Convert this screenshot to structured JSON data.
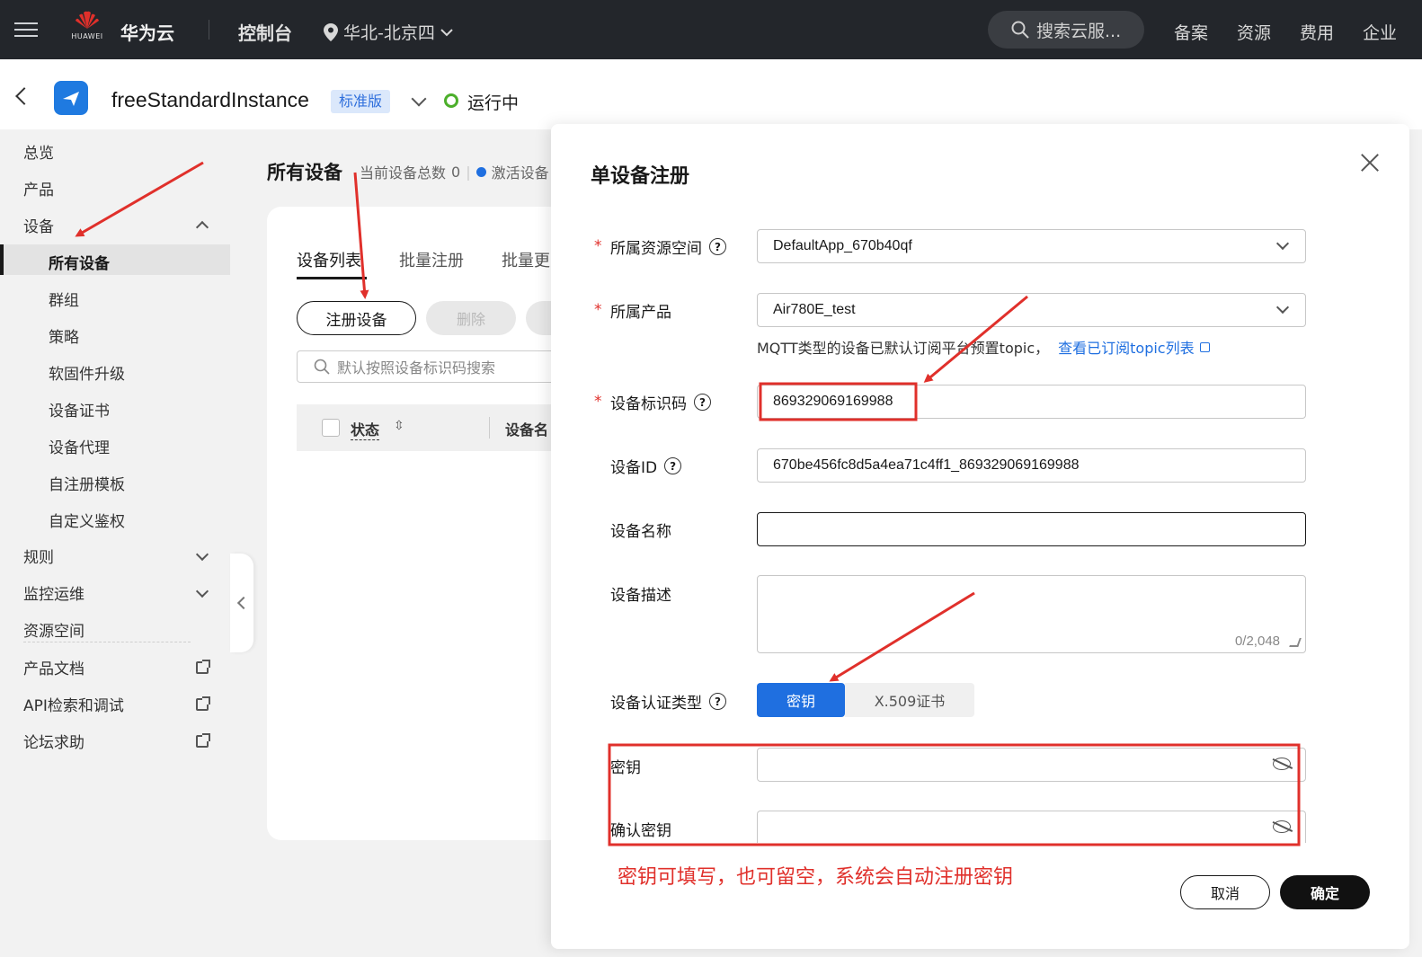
{
  "topbar": {
    "logo_text": "HUAWEI",
    "brand": "华为云",
    "console": "控制台",
    "region": "华北-北京四",
    "search_placeholder": "搜索云服...",
    "links": [
      "备案",
      "资源",
      "费用",
      "企业"
    ]
  },
  "instance": {
    "name": "freeStandardInstance",
    "edition": "标准版",
    "status": "运行中"
  },
  "sidebar": {
    "items": [
      {
        "label": "总览"
      },
      {
        "label": "产品"
      },
      {
        "label": "设备"
      }
    ],
    "device_sub": [
      "所有设备",
      "群组",
      "策略",
      "软固件升级",
      "设备证书",
      "设备代理",
      "自注册模板",
      "自定义鉴权"
    ],
    "more": [
      {
        "label": "规则"
      },
      {
        "label": "监控运维"
      },
      {
        "label": "资源空间"
      }
    ],
    "external": [
      {
        "label": "产品文档"
      },
      {
        "label": "API检索和调试"
      },
      {
        "label": "论坛求助"
      }
    ]
  },
  "main": {
    "title": "所有设备",
    "total_label": "当前设备总数",
    "total_value": "0",
    "active_label": "激活设备",
    "tabs": [
      "设备列表",
      "批量注册",
      "批量更"
    ],
    "register_button": "注册设备",
    "delete_button": "删除",
    "search_placeholder": "默认按照设备标识码搜索",
    "columns": [
      "状态",
      "设备名"
    ]
  },
  "dialog": {
    "title": "单设备注册",
    "resource_space_label": "所属资源空间",
    "resource_space_value": "DefaultApp_670b40qf",
    "product_label": "所属产品",
    "product_value": "Air780E_test",
    "hint_text": "MQTT类型的设备已默认订阅平台预置topic，",
    "hint_link": "查看已订阅topic列表",
    "node_id_label": "设备标识码",
    "node_id_value": "869329069169988",
    "device_id_label": "设备ID",
    "device_id_value": "670be456fc8d5a4ea71c4ff1_869329069169988",
    "device_name_label": "设备名称",
    "device_name_value": "",
    "description_label": "设备描述",
    "description_counter": "0/2,048",
    "auth_type_label": "设备认证类型",
    "auth_secret": "密钥",
    "auth_x509": "X.509证书",
    "secret_label": "密钥",
    "confirm_secret_label": "确认密钥",
    "note": "密钥可填写，也可留空，系统会自动注册密钥",
    "cancel_button": "取消",
    "ok_button": "确定"
  },
  "colors": {
    "topbar_bg": "#23262b",
    "accent_blue": "#1f6fe0",
    "status_green": "#4caf2b",
    "annotation_red": "#e0302b"
  }
}
